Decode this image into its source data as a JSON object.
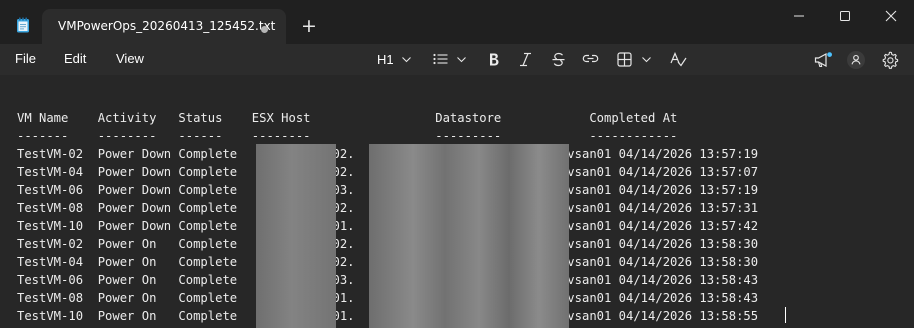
{
  "titlebar": {
    "tab_title": "VMPowerOps_20260413_125452.txt",
    "new_tab_label": "+",
    "icons": [
      "notepad-icon",
      "unsaved-dot-icon",
      "minimize-icon",
      "maximize-icon",
      "close-icon"
    ]
  },
  "menubar": {
    "file": "File",
    "edit": "Edit",
    "view": "View",
    "heading": "H1",
    "icons": [
      "heading-chevron-icon",
      "list-icon",
      "list-chevron-icon",
      "bold-icon",
      "italic-icon",
      "strikethrough-icon",
      "link-icon",
      "table-icon",
      "table-chevron-icon",
      "spellcheck-icon",
      "announcement-icon",
      "account-icon",
      "gear-icon"
    ]
  },
  "editor": {
    "lines": [
      "",
      "",
      "VM Name    Activity   Status    ESX Host                 Datastore            Completed At",
      "-------    --------   ------    --------                 ---------            ------------",
      "TestVM-02  Power Down Complete            -02.                            -vsan01 04/14/2026 13:57:19",
      "TestVM-04  Power Down Complete            -02.                            -vsan01 04/14/2026 13:57:07",
      "TestVM-06  Power Down Complete            -03.                            -vsan01 04/14/2026 13:57:19",
      "TestVM-08  Power Down Complete            -02.                            -vsan01 04/14/2026 13:57:31",
      "TestVM-10  Power Down Complete            -01.                            -vsan01 04/14/2026 13:57:42",
      "TestVM-02  Power On   Complete            -02.                            -vsan01 04/14/2026 13:58:30",
      "TestVM-04  Power On   Complete            -02.                            -vsan01 04/14/2026 13:58:30",
      "TestVM-06  Power On   Complete            -03.                            -vsan01 04/14/2026 13:58:43",
      "TestVM-08  Power On   Complete            -01.                            -vsan01 04/14/2026 13:58:43",
      "TestVM-10  Power On   Complete            -01.                            -vsan01 04/14/2026 13:58:55"
    ]
  },
  "colors": {
    "titlebar_bg": "#202020",
    "toolbar_bg": "#2c2c2c",
    "editor_bg": "#272727",
    "text": "#ececec",
    "accent": "#4cc2ff"
  }
}
